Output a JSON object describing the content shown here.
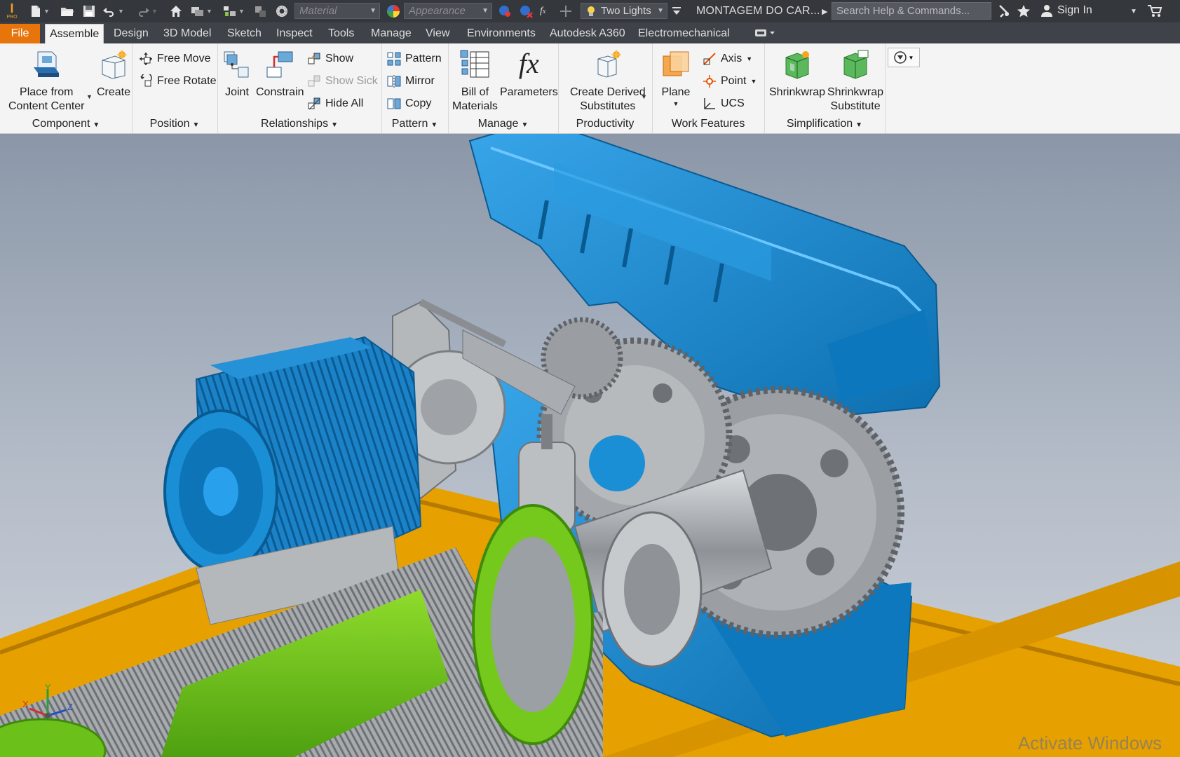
{
  "titlebar": {
    "app_badge": "PRO",
    "material_placeholder": "Material",
    "appearance_placeholder": "Appearance",
    "lighting": "Two Lights",
    "document_title": "MONTAGEM DO CAR...",
    "search_placeholder": "Search Help & Commands...",
    "sign_in": "Sign In"
  },
  "menu": {
    "file": "File",
    "tabs": [
      "Assemble",
      "Design",
      "3D Model",
      "Sketch",
      "Inspect",
      "Tools",
      "Manage",
      "View",
      "Environments",
      "Autodesk A360",
      "Electromechanical"
    ],
    "active_tab": "Assemble"
  },
  "ribbon": {
    "component": {
      "title": "Component",
      "place_line1": "Place from",
      "place_line2": "Content Center",
      "create": "Create"
    },
    "position": {
      "title": "Position",
      "free_move": "Free Move",
      "free_rotate": "Free Rotate"
    },
    "relationships": {
      "title": "Relationships",
      "joint": "Joint",
      "constrain": "Constrain",
      "show": "Show",
      "show_sick": "Show Sick",
      "hide_all": "Hide All"
    },
    "pattern": {
      "title": "Pattern",
      "pattern": "Pattern",
      "mirror": "Mirror",
      "copy": "Copy"
    },
    "manage": {
      "title": "Manage",
      "bom_line1": "Bill of",
      "bom_line2": "Materials",
      "parameters": "Parameters",
      "fx_symbol": "fx"
    },
    "productivity": {
      "title": "Productivity",
      "derived_line1": "Create Derived",
      "derived_line2": "Substitutes"
    },
    "work_features": {
      "title": "Work Features",
      "plane": "Plane",
      "axis": "Axis",
      "point": "Point",
      "ucs": "UCS"
    },
    "simplification": {
      "title": "Simplification",
      "shrinkwrap": "Shrinkwrap",
      "shrinkwrap_sub_line1": "Shrinkwrap",
      "shrinkwrap_sub_line2": "Substitute"
    }
  },
  "viewport": {
    "triad": {
      "x": "X",
      "y": "Y",
      "z": "Z"
    },
    "watermark": "Activate Windows"
  },
  "colors": {
    "file_tab": "#e8740c",
    "housing_blue": "#1a8fd6",
    "drum_green": "#6cc01a",
    "frame_orange": "#e6a000",
    "steel_gray": "#a9acb0"
  }
}
